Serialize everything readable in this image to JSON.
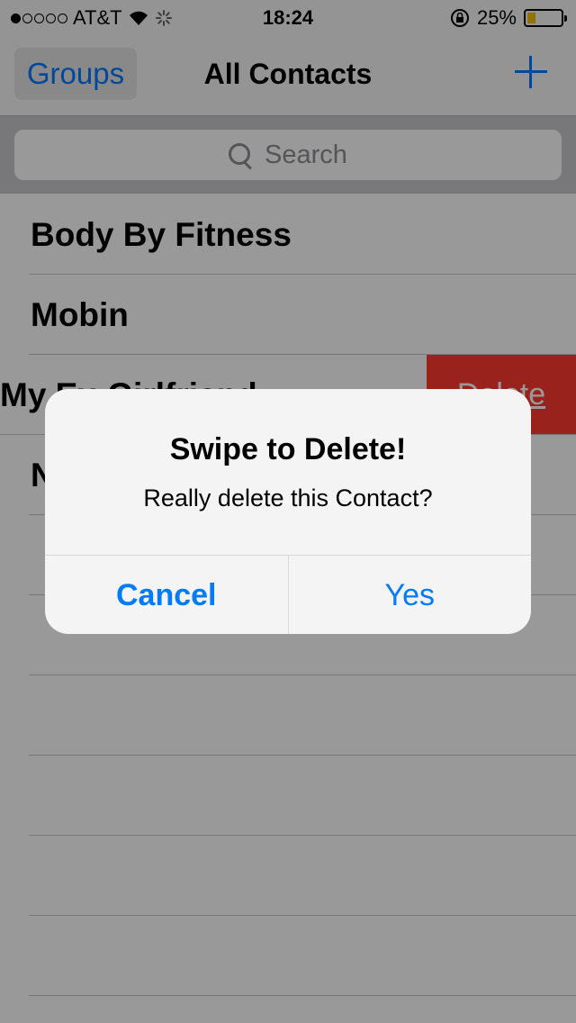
{
  "status_bar": {
    "carrier": "AT&T",
    "time": "18:24",
    "battery_percent": "25%",
    "battery_level": 0.25,
    "signal_bars": 1,
    "signal_total": 5,
    "wifi_icon": "wifi-icon",
    "activity_icon": "activity-spinner-icon",
    "rotation_lock_icon": "rotation-lock-icon",
    "battery_color": "#f2c100"
  },
  "nav": {
    "groups_label": "Groups",
    "title": "All Contacts",
    "add_icon": "plus-icon"
  },
  "search": {
    "placeholder": "Search",
    "icon": "search-icon"
  },
  "contacts": [
    {
      "name": "Body By Fitness"
    },
    {
      "name": "Mobin"
    },
    {
      "name": "My Ex-Girlfriend",
      "swiped": true,
      "action_label": "Delete"
    },
    {
      "name": "N"
    }
  ],
  "alert": {
    "title": "Swipe to Delete!",
    "message": "Really delete this Contact?",
    "cancel_label": "Cancel",
    "confirm_label": "Yes"
  },
  "colors": {
    "accent": "#007aff",
    "destructive": "#ff3b30"
  }
}
